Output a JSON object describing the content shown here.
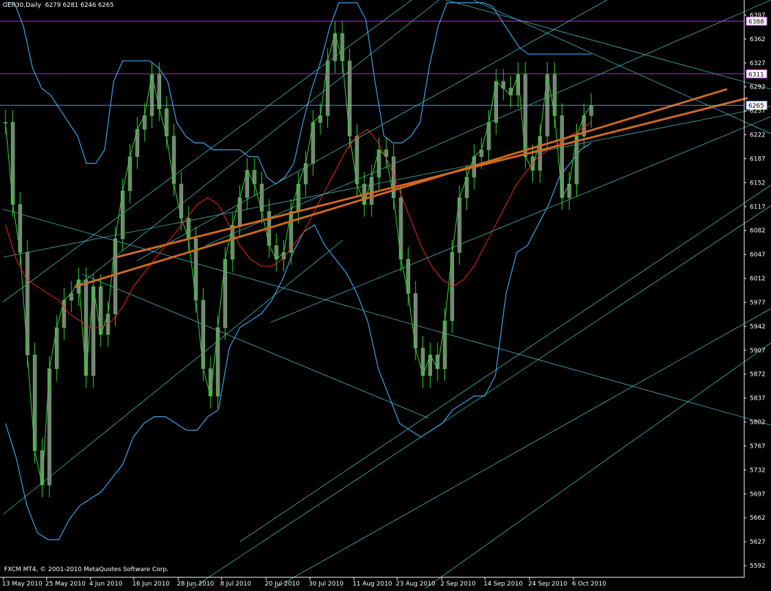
{
  "chart_header": {
    "symbol": "GER30,Daily",
    "ohlc": "6279 6281 6246 6265"
  },
  "copyright": "FXCM MT4, © 2001-2010 MetaQuotes Software Corp.",
  "colors": {
    "background": "#000000",
    "candle": "#808080",
    "price_line": "#33dd33",
    "ma_red": "#ff2020",
    "bollinger": "#3aa8f0",
    "channel": "#55dddd",
    "trend_orange": "#d2691e",
    "level_line": "#cc44ff",
    "last_price_line": "#88aaff",
    "axis": "#ffffff"
  },
  "chart_data": {
    "type": "line",
    "instrument": "GER30",
    "timeframe": "Daily",
    "ylim": [
      5575,
      6415
    ],
    "y_ticks": [
      5592,
      5627,
      5662,
      5697,
      5732,
      5767,
      5802,
      5837,
      5872,
      5907,
      5942,
      5977,
      6012,
      6047,
      6082,
      6117,
      6152,
      6187,
      6222,
      6257,
      6292,
      6327,
      6362,
      6397
    ],
    "x_labels": [
      "13 May 2010",
      "25 May 2010",
      "4 Jun 2010",
      "16 Jun 2010",
      "28 Jun 2010",
      "8 Jul 2010",
      "20 Jul 2010",
      "30 Jul 2010",
      "11 Aug 2010",
      "23 Aug 2010",
      "2 Sep 2010",
      "14 Sep 2010",
      "24 Sep 2010",
      "6 Oct 2010"
    ],
    "price_levels": [
      {
        "label": "6388",
        "value": 6388,
        "color": "#cc44ff"
      },
      {
        "label": "6311",
        "value": 6311,
        "color": "#cc44ff"
      },
      {
        "label": "6265",
        "value": 6265,
        "color": "#88aaff"
      }
    ],
    "close": [
      6240,
      6120,
      6050,
      5900,
      5760,
      5710,
      5880,
      5940,
      5980,
      5990,
      6010,
      5870,
      6000,
      5930,
      5960,
      6070,
      6140,
      6190,
      6230,
      6250,
      6310,
      6260,
      6220,
      6150,
      6100,
      6070,
      5980,
      5880,
      5840,
      5940,
      6040,
      6090,
      6130,
      6170,
      6150,
      6110,
      6060,
      6040,
      6050,
      6110,
      6150,
      6180,
      6240,
      6250,
      6330,
      6370,
      6330,
      6220,
      6150,
      6120,
      6160,
      6200,
      6190,
      6130,
      6040,
      5990,
      5910,
      5870,
      5900,
      5880,
      5950,
      6050,
      6130,
      6160,
      6190,
      6200,
      6240,
      6300,
      6290,
      6280,
      6310,
      6190,
      6170,
      6220,
      6310,
      6250,
      6130,
      6150,
      6220,
      6250,
      6265
    ],
    "bollinger_upper": [
      6440,
      6420,
      6380,
      6320,
      6290,
      6280,
      6260,
      6240,
      6220,
      6180,
      6180,
      6200,
      6300,
      6330,
      6330,
      6330,
      6330,
      6320,
      6300,
      6240,
      6220,
      6210,
      6210,
      6200,
      6200,
      6200,
      6200,
      6190,
      6190,
      6160,
      6150,
      6160,
      6180,
      6240,
      6290,
      6330,
      6380,
      6420,
      6440,
      6420,
      6390,
      6300,
      6220,
      6210,
      6210,
      6220,
      6240,
      6320,
      6380,
      6430,
      6460,
      6460,
      6470,
      6450,
      6410,
      6390,
      6370,
      6350,
      6340,
      6340,
      6340,
      6340,
      6340,
      6340,
      6340,
      6340
    ],
    "bollinger_lower": [
      5800,
      5750,
      5680,
      5640,
      5630,
      5630,
      5660,
      5680,
      5690,
      5700,
      5720,
      5740,
      5780,
      5800,
      5810,
      5810,
      5800,
      5790,
      5790,
      5810,
      5820,
      5910,
      5940,
      5950,
      5960,
      5980,
      6010,
      6050,
      6080,
      6090,
      6060,
      6040,
      6020,
      5990,
      5950,
      5880,
      5840,
      5800,
      5790,
      5780,
      5790,
      5800,
      5820,
      5830,
      5840,
      5840,
      5870,
      5990,
      6050,
      6060,
      6090,
      6120,
      6160,
      6180,
      6200,
      6210
    ],
    "ma_red": [
      6090,
      6040,
      6010,
      6000,
      5990,
      5980,
      5960,
      5950,
      5940,
      5940,
      5950,
      5970,
      6000,
      6020,
      6040,
      6060,
      6080,
      6100,
      6120,
      6130,
      6120,
      6090,
      6060,
      6040,
      6030,
      6030,
      6040,
      6060,
      6080,
      6110,
      6140,
      6170,
      6200,
      6220,
      6230,
      6210,
      6180,
      6140,
      6100,
      6060,
      6030,
      6010,
      6000,
      6010,
      6030,
      6060,
      6090,
      6120,
      6150,
      6170,
      6190,
      6200,
      6210,
      6220,
      6230,
      6240
    ]
  }
}
